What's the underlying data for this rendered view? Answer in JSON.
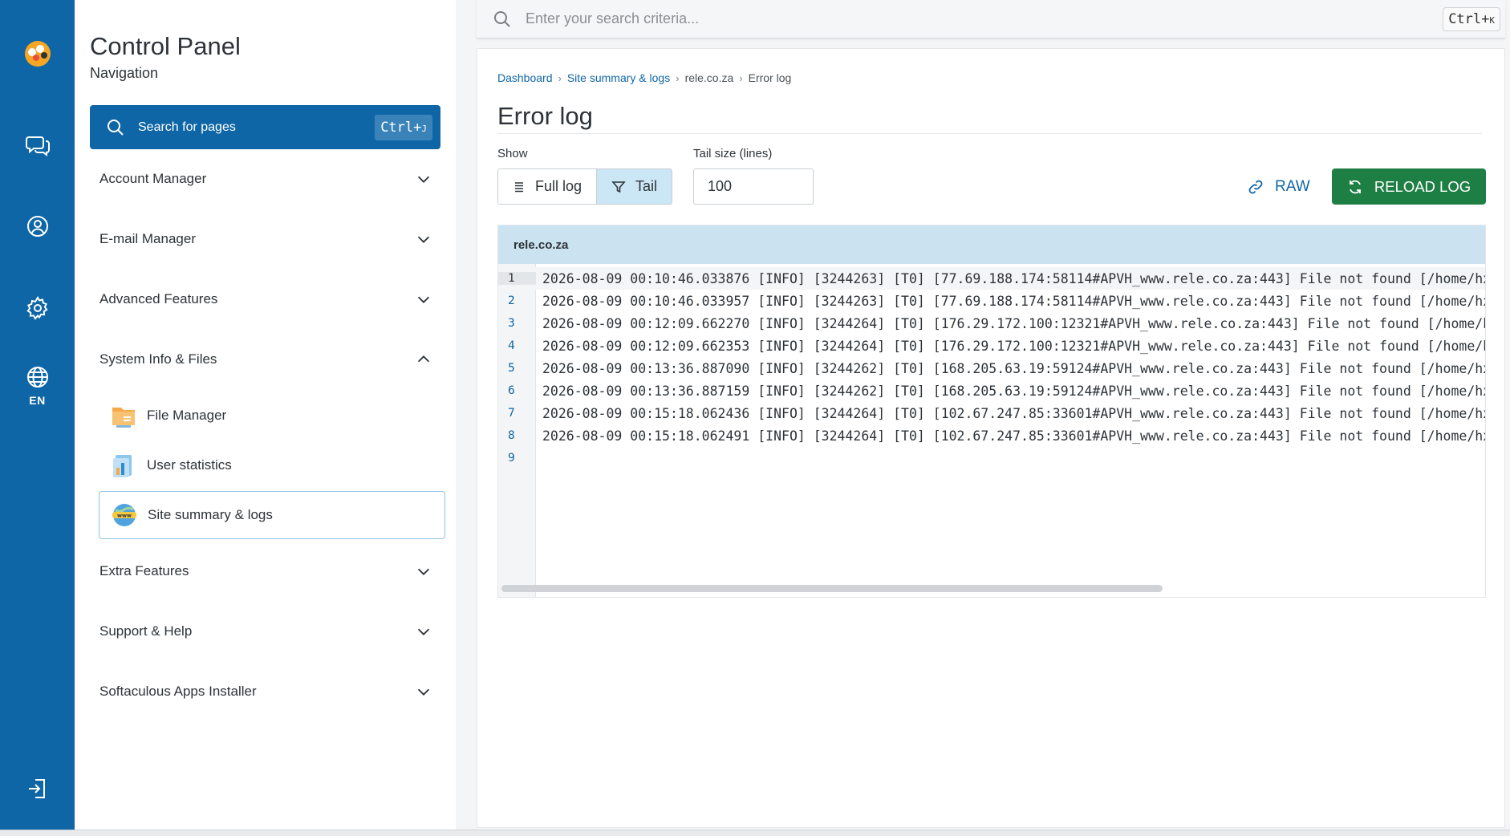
{
  "rail": {
    "language": "EN"
  },
  "nav": {
    "title": "Control Panel",
    "subtitle": "Navigation",
    "search_label": "Search for pages",
    "search_kbd": "Ctrl+",
    "search_kbd_key": "J",
    "sections": [
      {
        "label": "Account Manager"
      },
      {
        "label": "E-mail Manager"
      },
      {
        "label": "Advanced Features"
      },
      {
        "label": "System Info & Files"
      },
      {
        "label": "Extra Features"
      },
      {
        "label": "Support & Help"
      },
      {
        "label": "Softaculous Apps Installer"
      }
    ],
    "sub_items": [
      {
        "label": "File Manager",
        "icon": "folder-icon"
      },
      {
        "label": "User statistics",
        "icon": "stats-icon"
      },
      {
        "label": "Site summary & logs",
        "icon": "www-globe-icon"
      }
    ]
  },
  "topbar": {
    "placeholder": "Enter your search criteria...",
    "kbd": "Ctrl+",
    "kbd_key": "K"
  },
  "breadcrumb": [
    "Dashboard",
    "Site summary & logs",
    "rele.co.za",
    "Error log"
  ],
  "page": {
    "title": "Error log",
    "show_label": "Show",
    "tail_label": "Tail size (lines)",
    "full_log": "Full log",
    "tail": "Tail",
    "tail_value": "100",
    "raw": "RAW",
    "reload": "RELOAD LOG"
  },
  "log": {
    "domain": "rele.co.za",
    "lines": [
      {
        "n": "1",
        "text": "2026-08-09 00:10:46.033876 [INFO] [3244263] [T0] [77.69.188.174:58114#APVH_www.rele.co.za:443] File not found [/home/hx"
      },
      {
        "n": "2",
        "text": "2026-08-09 00:10:46.033957 [INFO] [3244263] [T0] [77.69.188.174:58114#APVH_www.rele.co.za:443] File not found [/home/hx"
      },
      {
        "n": "3",
        "text": "2026-08-09 00:12:09.662270 [INFO] [3244264] [T0] [176.29.172.100:12321#APVH_www.rele.co.za:443] File not found [/home/h"
      },
      {
        "n": "4",
        "text": "2026-08-09 00:12:09.662353 [INFO] [3244264] [T0] [176.29.172.100:12321#APVH_www.rele.co.za:443] File not found [/home/h"
      },
      {
        "n": "5",
        "text": "2026-08-09 00:13:36.887090 [INFO] [3244262] [T0] [168.205.63.19:59124#APVH_www.rele.co.za:443] File not found [/home/hx"
      },
      {
        "n": "6",
        "text": "2026-08-09 00:13:36.887159 [INFO] [3244262] [T0] [168.205.63.19:59124#APVH_www.rele.co.za:443] File not found [/home/hx"
      },
      {
        "n": "7",
        "text": "2026-08-09 00:15:18.062436 [INFO] [3244264] [T0] [102.67.247.85:33601#APVH_www.rele.co.za:443] File not found [/home/hx"
      },
      {
        "n": "8",
        "text": "2026-08-09 00:15:18.062491 [INFO] [3244264] [T0] [102.67.247.85:33601#APVH_www.rele.co.za:443] File not found [/home/hx"
      },
      {
        "n": "9",
        "text": ""
      }
    ]
  },
  "colors": {
    "brand": "#0f66a7",
    "reload": "#1e7f44",
    "tail_active": "#cbe6f5",
    "log_header": "#cbe3f1"
  }
}
